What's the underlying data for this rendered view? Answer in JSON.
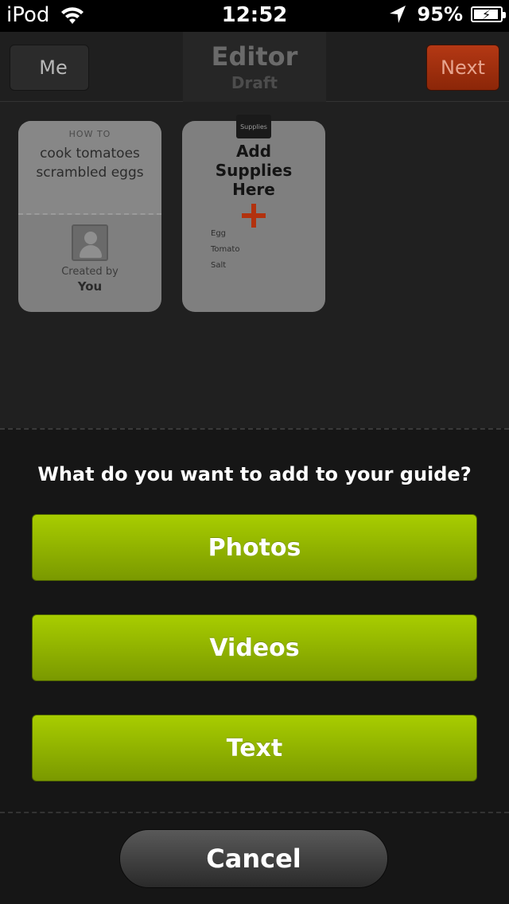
{
  "status_bar": {
    "device": "iPod",
    "time": "12:52",
    "battery": "95%",
    "icons": [
      "wifi-icon",
      "location-arrow-icon",
      "battery-charging-icon"
    ]
  },
  "nav": {
    "back_label": "Me",
    "title": "Editor",
    "subtitle": "Draft",
    "next_label": "Next"
  },
  "cards": {
    "howto": {
      "label": "HOW TO",
      "title_line1": "cook tomatoes",
      "title_line2": "scrambled eggs",
      "created_label": "Created by",
      "created_by": "You"
    },
    "supplies": {
      "tag": "Supplies",
      "line1": "Add",
      "line2": "Supplies",
      "line3": "Here",
      "items": [
        "Egg",
        "Tomato",
        "Salt"
      ]
    }
  },
  "sheet": {
    "question": "What do you want to add to your guide?",
    "options": [
      "Photos",
      "Videos",
      "Text"
    ],
    "cancel_label": "Cancel"
  },
  "colors": {
    "accent_green": "#9bbf00",
    "next_orange": "#a33010",
    "plus_red": "#b2320e"
  }
}
